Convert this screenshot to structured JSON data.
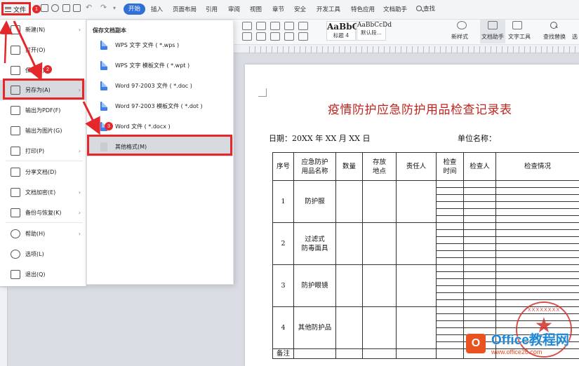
{
  "menubar": {
    "file_label": "文件",
    "tabs": [
      "开始",
      "插入",
      "页面布局",
      "引用",
      "审阅",
      "视图",
      "章节",
      "安全",
      "开发工具",
      "特色应用",
      "文档助手"
    ],
    "search_label": "查找"
  },
  "ribbon": {
    "styles": [
      {
        "sample": "AaBbC",
        "label": "标题 4"
      },
      {
        "sample": "AaBbCcDd",
        "label": "默认段..."
      }
    ],
    "buttons": [
      "新样式",
      "文档助手",
      "文字工具",
      "查找替换",
      "选"
    ]
  },
  "file_menu": {
    "items": [
      {
        "label": "新建(N)",
        "has_arrow": true
      },
      {
        "label": "打开(O)",
        "has_arrow": false
      },
      {
        "label": "保存(S)",
        "has_arrow": false
      },
      {
        "label": "另存为(A)",
        "has_arrow": true
      },
      {
        "label": "输出为PDF(F)",
        "has_arrow": false
      },
      {
        "label": "输出为图片(G)",
        "has_arrow": false
      },
      {
        "label": "打印(P)",
        "has_arrow": true
      },
      {
        "label": "分享文档(D)",
        "has_arrow": false
      },
      {
        "label": "文档加密(E)",
        "has_arrow": true
      },
      {
        "label": "备份与恢复(K)",
        "has_arrow": true
      },
      {
        "label": "帮助(H)",
        "has_arrow": true
      },
      {
        "label": "选项(L)",
        "has_arrow": false
      },
      {
        "label": "退出(Q)",
        "has_arrow": false
      }
    ]
  },
  "save_as_menu": {
    "header": "保存文档副本",
    "items": [
      "WPS 文字 文件 ( *.wps )",
      "WPS 文字 模板文件 ( *.wpt )",
      "Word 97-2003 文件 ( *.doc )",
      "Word 97-2003 模板文件 ( *.dot )",
      "Word 文件 ( *.docx )",
      "其他格式(M)"
    ]
  },
  "annotations": {
    "steps": [
      "1",
      "2",
      "3"
    ],
    "color": "#e3272b"
  },
  "document": {
    "title": "疫情防护应急防护用品检查记录表",
    "date_label": "日期：20XX 年 XX 月 XX 日",
    "unit_label": "单位名称：",
    "headers": {
      "seq": "序号",
      "item_a": "应急防护",
      "item_b": "用品名称",
      "qty": "数量",
      "loc_a": "存放",
      "loc_b": "地点",
      "person": "责任人",
      "time_a": "检查",
      "time_b": "时间",
      "inspector": "检查人",
      "status": "检查情况"
    },
    "rows": [
      {
        "seq": "1",
        "name_a": "防护服",
        "name_b": ""
      },
      {
        "seq": "2",
        "name_a": "过滤式",
        "name_b": "防毒面具"
      },
      {
        "seq": "3",
        "name_a": "防护眼镜",
        "name_b": ""
      },
      {
        "seq": "4",
        "name_a": "其他防护品",
        "name_b": ""
      }
    ],
    "remark": "备注"
  },
  "watermark": {
    "text": "Office教程网",
    "sub": "www.office26.com",
    "logo_letter": "O",
    "stamp_ring": "XXXXXXXX"
  }
}
